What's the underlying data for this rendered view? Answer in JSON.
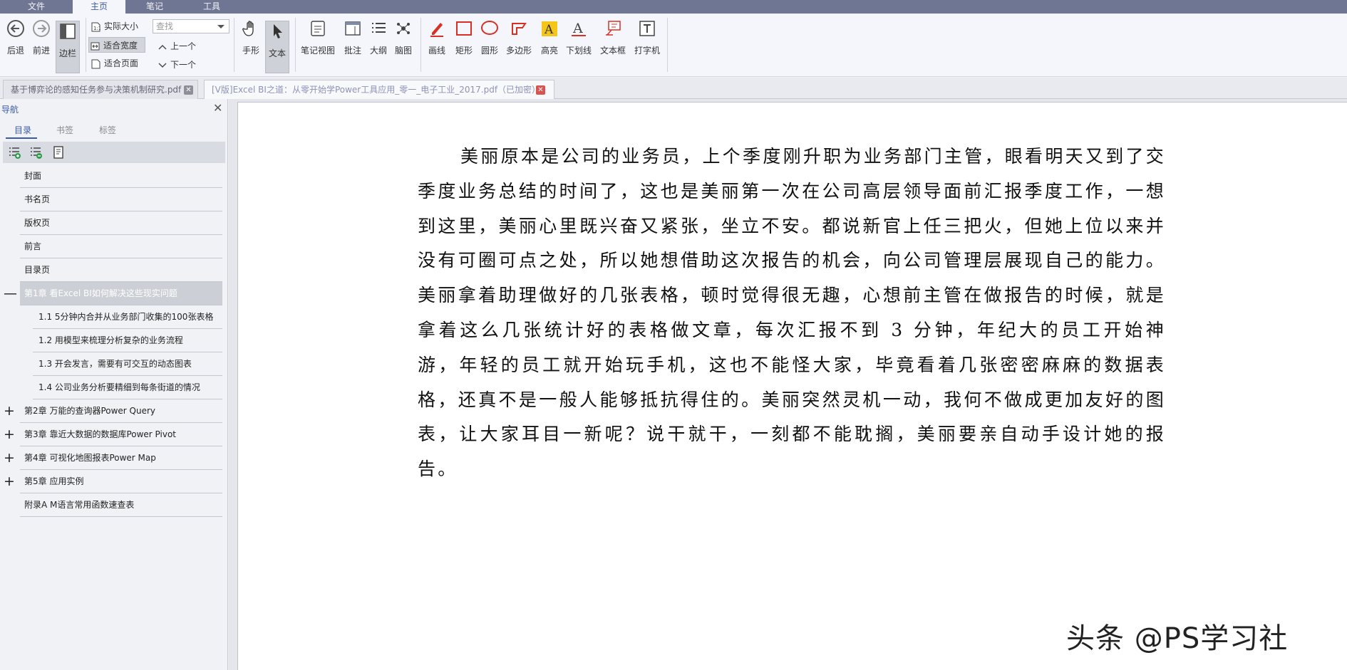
{
  "menu": {
    "tabs": [
      "文件",
      "主页",
      "笔记",
      "工具"
    ],
    "active": "主页"
  },
  "ribbon": {
    "back": "后退",
    "forward": "前进",
    "sidebar": "边栏",
    "actual_size": "实际大小",
    "fit_width": "适合宽度",
    "fit_page": "适合页面",
    "search_placeholder": "查找",
    "prev": "上一个",
    "next": "下一个",
    "hand": "手形",
    "text": "文本",
    "note_view": "笔记视图",
    "annotate": "批注",
    "outline": "大纲",
    "mindmap": "脑图",
    "pen": "画线",
    "rect": "矩形",
    "circle": "圆形",
    "polygon": "多边形",
    "highlight": "高亮",
    "underline": "下划线",
    "textbox": "文本框",
    "typewriter": "打字机"
  },
  "doc_tabs": [
    {
      "title": "基于博弈论的感知任务参与决策机制研究.pdf",
      "close": "✕"
    },
    {
      "title": "[V版]Excel BI之道：从零开始学Power工具应用_零一_电子工业_2017.pdf（已加密）",
      "close": "✕"
    }
  ],
  "nav": {
    "title": "导航",
    "close": "✕",
    "tabs": [
      "目录",
      "书签",
      "标签"
    ],
    "toc": [
      {
        "label": "封面",
        "level": 0,
        "expander": ""
      },
      {
        "label": "书名页",
        "level": 0,
        "expander": ""
      },
      {
        "label": "版权页",
        "level": 0,
        "expander": ""
      },
      {
        "label": "前言",
        "level": 0,
        "expander": ""
      },
      {
        "label": "目录页",
        "level": 0,
        "expander": ""
      },
      {
        "label": "第1章  看Excel BI如何解决这些现实问题",
        "level": 0,
        "expander": "—",
        "highlighted": true
      },
      {
        "label": "1.1  5分钟内合并从业务部门收集的100张表格",
        "level": 1,
        "expander": ""
      },
      {
        "label": "1.2  用模型来梳理分析复杂的业务流程",
        "level": 1,
        "expander": ""
      },
      {
        "label": "1.3  开会发言，需要有可交互的动态图表",
        "level": 1,
        "expander": ""
      },
      {
        "label": "1.4  公司业务分析要精细到每条街道的情况",
        "level": 1,
        "expander": ""
      },
      {
        "label": "第2章  万能的查询器Power Query",
        "level": 0,
        "expander": "+"
      },
      {
        "label": "第3章  靠近大数据的数据库Power Pivot",
        "level": 0,
        "expander": "+"
      },
      {
        "label": "第4章  可视化地图报表Power Map",
        "level": 0,
        "expander": "+"
      },
      {
        "label": "第5章  应用实例",
        "level": 0,
        "expander": "+"
      },
      {
        "label": "附录A  M语言常用函数速查表",
        "level": 0,
        "expander": ""
      }
    ]
  },
  "page": {
    "paragraph": "美丽原本是公司的业务员，上个季度刚升职为业务部门主管，眼看明天又到了交季度业务总结的时间了，这也是美丽第一次在公司高层领导面前汇报季度工作，一想到这里，美丽心里既兴奋又紧张，坐立不安。都说新官上任三把火，但她上位以来并没有可圈可点之处，所以她想借助这次报告的机会，向公司管理层展现自己的能力。美丽拿着助理做好的几张表格，顿时觉得很无趣，心想前主管在做报告的时候，就是拿着这么几张统计好的表格做文章，每次汇报不到 3 分钟，年纪大的员工开始神游，年轻的员工就开始玩手机，这也不能怪大家，毕竟看着几张密密麻麻的数据表格，还真不是一般人能够抵抗得住的。美丽突然灵机一动，我何不做成更加友好的图表，让大家耳目一新呢？说干就干，一刻都不能耽搁，美丽要亲自动手设计她的报告。"
  },
  "watermark": "头条 @PS学习社",
  "colors": {
    "menubar": "#6f7694",
    "accent": "#3a5ba8",
    "annot_red": "#d93025",
    "highlight_yellow": "#f5c518"
  }
}
